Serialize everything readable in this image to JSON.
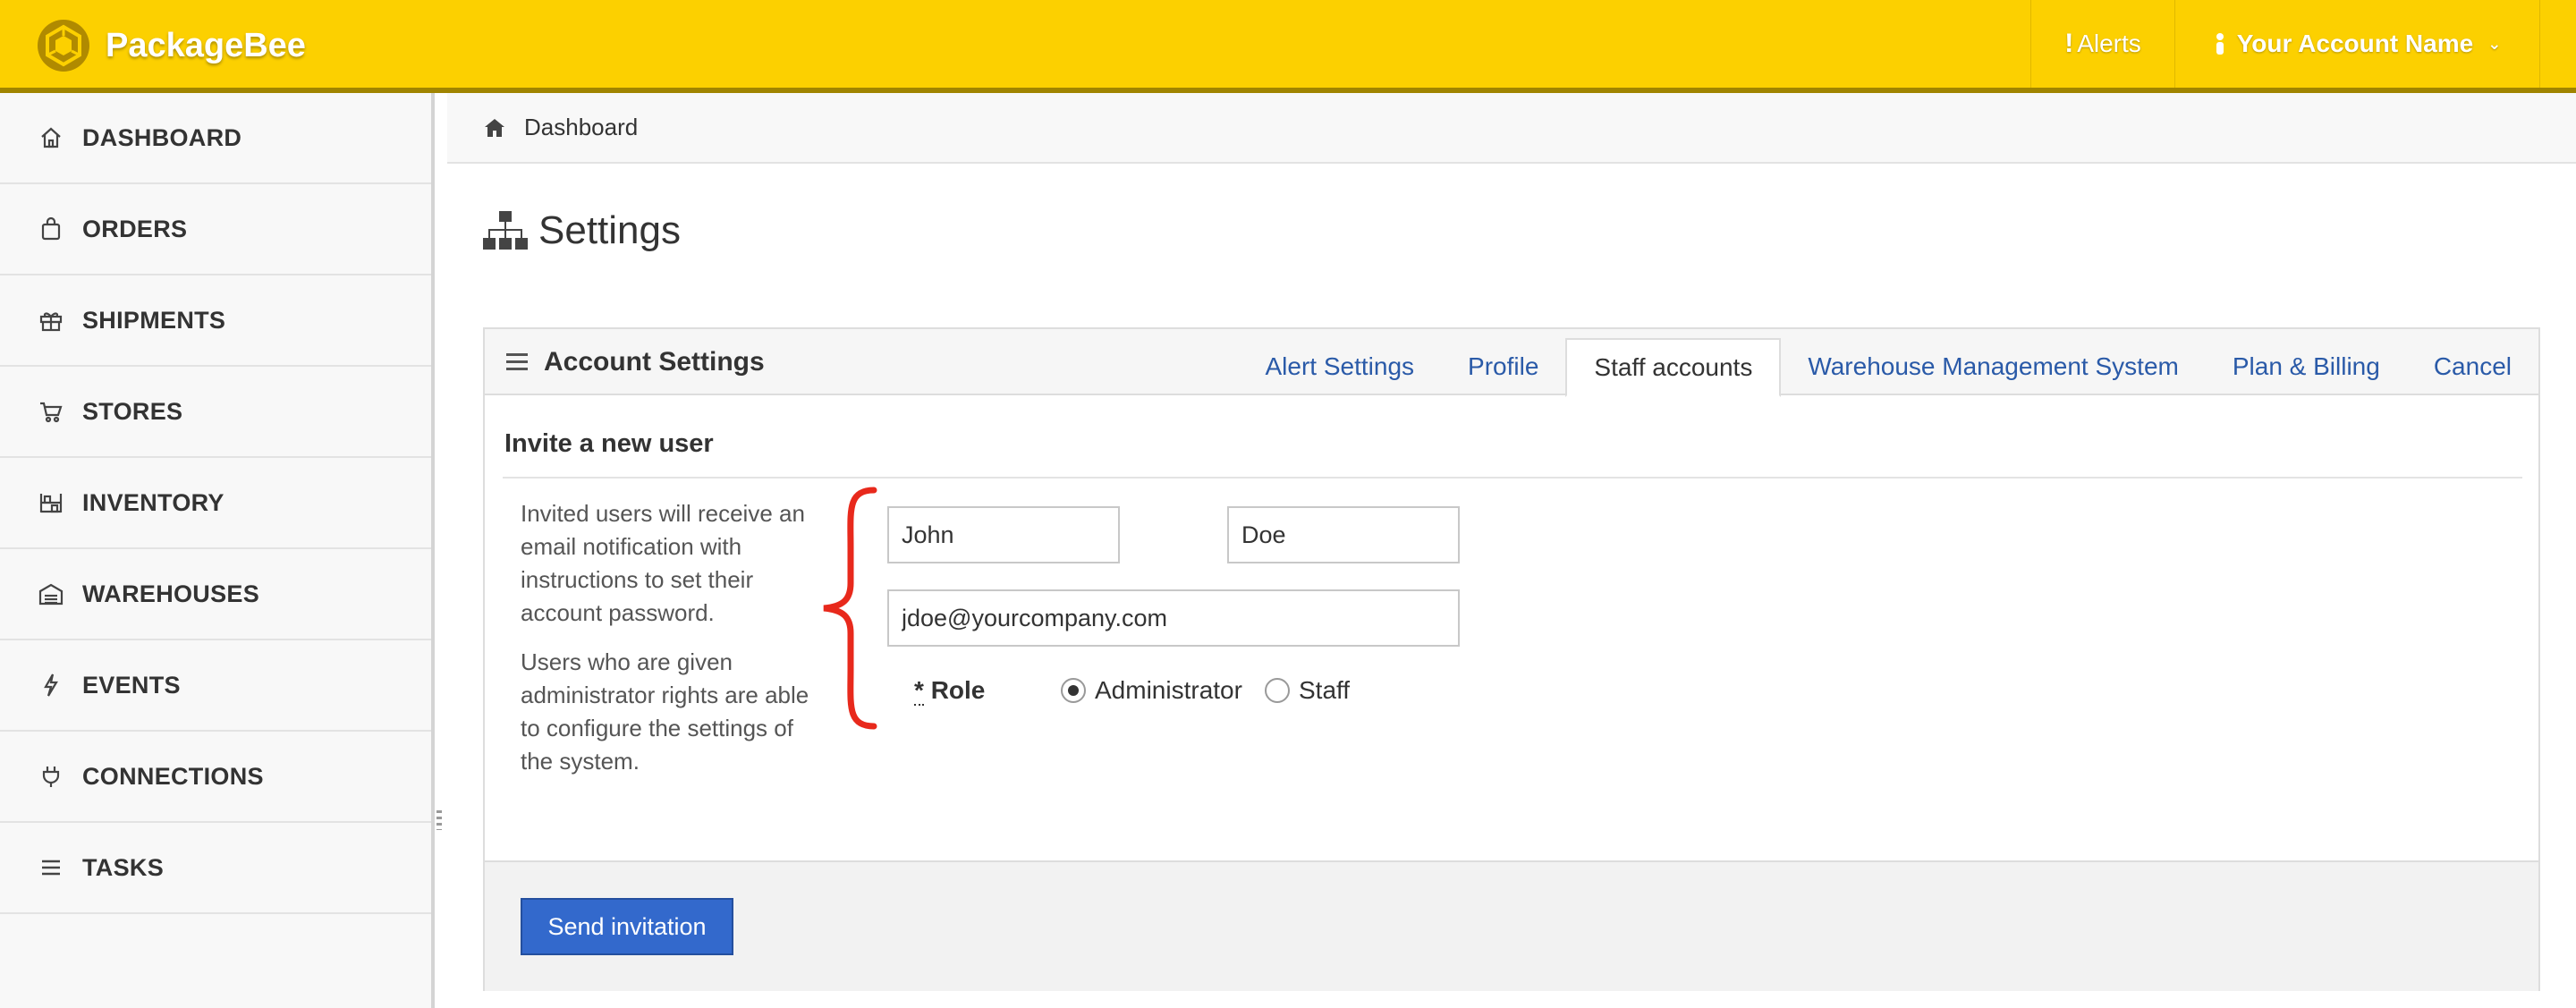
{
  "app": {
    "name": "PackageBee",
    "brand_color": "#fcd000",
    "accent_color": "#3369cc",
    "link_color": "#2a5aa8",
    "annotation_color": "#e8291c"
  },
  "header": {
    "alerts_label": "Alerts",
    "account_label": "Your Account Name"
  },
  "sidebar": {
    "items": [
      {
        "label": "DASHBOARD",
        "icon": "home-icon"
      },
      {
        "label": "ORDERS",
        "icon": "bag-icon"
      },
      {
        "label": "SHIPMENTS",
        "icon": "gift-box-icon"
      },
      {
        "label": "STORES",
        "icon": "cart-icon"
      },
      {
        "label": "INVENTORY",
        "icon": "shelves-icon"
      },
      {
        "label": "WAREHOUSES",
        "icon": "warehouse-icon"
      },
      {
        "label": "EVENTS",
        "icon": "lightning-icon"
      },
      {
        "label": "CONNECTIONS",
        "icon": "plug-icon"
      },
      {
        "label": "TASKS",
        "icon": "list-icon"
      }
    ]
  },
  "breadcrumb": {
    "icon": "home-icon",
    "label": "Dashboard"
  },
  "page": {
    "title": "Settings",
    "icon": "sitemap-icon"
  },
  "panel": {
    "title": "Account Settings",
    "tabs": [
      {
        "label": "Alert Settings",
        "active": false
      },
      {
        "label": "Profile",
        "active": false
      },
      {
        "label": "Staff accounts",
        "active": true
      },
      {
        "label": "Warehouse Management System",
        "active": false
      },
      {
        "label": "Plan & Billing",
        "active": false
      },
      {
        "label": "Cancel",
        "active": false
      }
    ]
  },
  "invite": {
    "heading": "Invite a new user",
    "help_1": "Invited users will receive an email notification with instructions to set their account password.",
    "help_2": "Users who are given administrator rights are able to configure the settings of the system.",
    "first_name": "John",
    "last_name": "Doe",
    "email": "jdoe@yourcompany.com",
    "role_required_mark": "*",
    "role_label": "Role",
    "role_options": [
      "Administrator",
      "Staff"
    ],
    "role_selected": "Administrator",
    "submit_label": "Send invitation"
  }
}
